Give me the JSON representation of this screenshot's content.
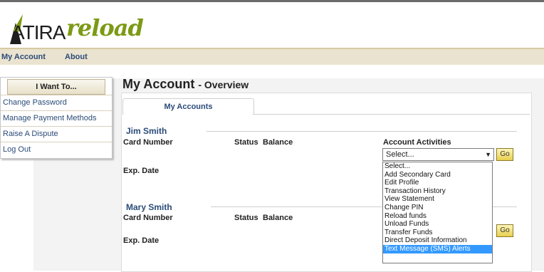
{
  "logo": {
    "text_main": "ATIRA",
    "text_reload": "reload"
  },
  "nav": {
    "items": [
      "My Account",
      "About"
    ]
  },
  "sidebar": {
    "header": "I Want To...",
    "items": [
      "Change Password",
      "Manage Payment Methods",
      "Raise A Dispute",
      "Log Out"
    ]
  },
  "page": {
    "title": "My Account",
    "subtitle": "- Overview"
  },
  "tabs": {
    "my_accounts": "My Accounts"
  },
  "accounts": [
    {
      "name": "Jim Smith",
      "card_number_label": "Card Number",
      "status_label": "Status",
      "balance_label": "Balance",
      "exp_label": "Exp. Date"
    },
    {
      "name": "Mary Smith",
      "card_number_label": "Card Number",
      "status_label": "Status",
      "balance_label": "Balance",
      "exp_label": "Exp. Date"
    }
  ],
  "activities": {
    "label": "Account Activities",
    "selected": "Select...",
    "go_label": "Go",
    "options": [
      "Select...",
      "Add Secondary Card",
      "Edit Profile",
      "Transaction History",
      "View Statement",
      "Change PIN",
      "Reload funds",
      "Unload Funds",
      "Transfer Funds",
      "Direct Deposit Information",
      "Text Message (SMS) Alerts"
    ],
    "highlighted": "Text Message (SMS) Alerts"
  }
}
